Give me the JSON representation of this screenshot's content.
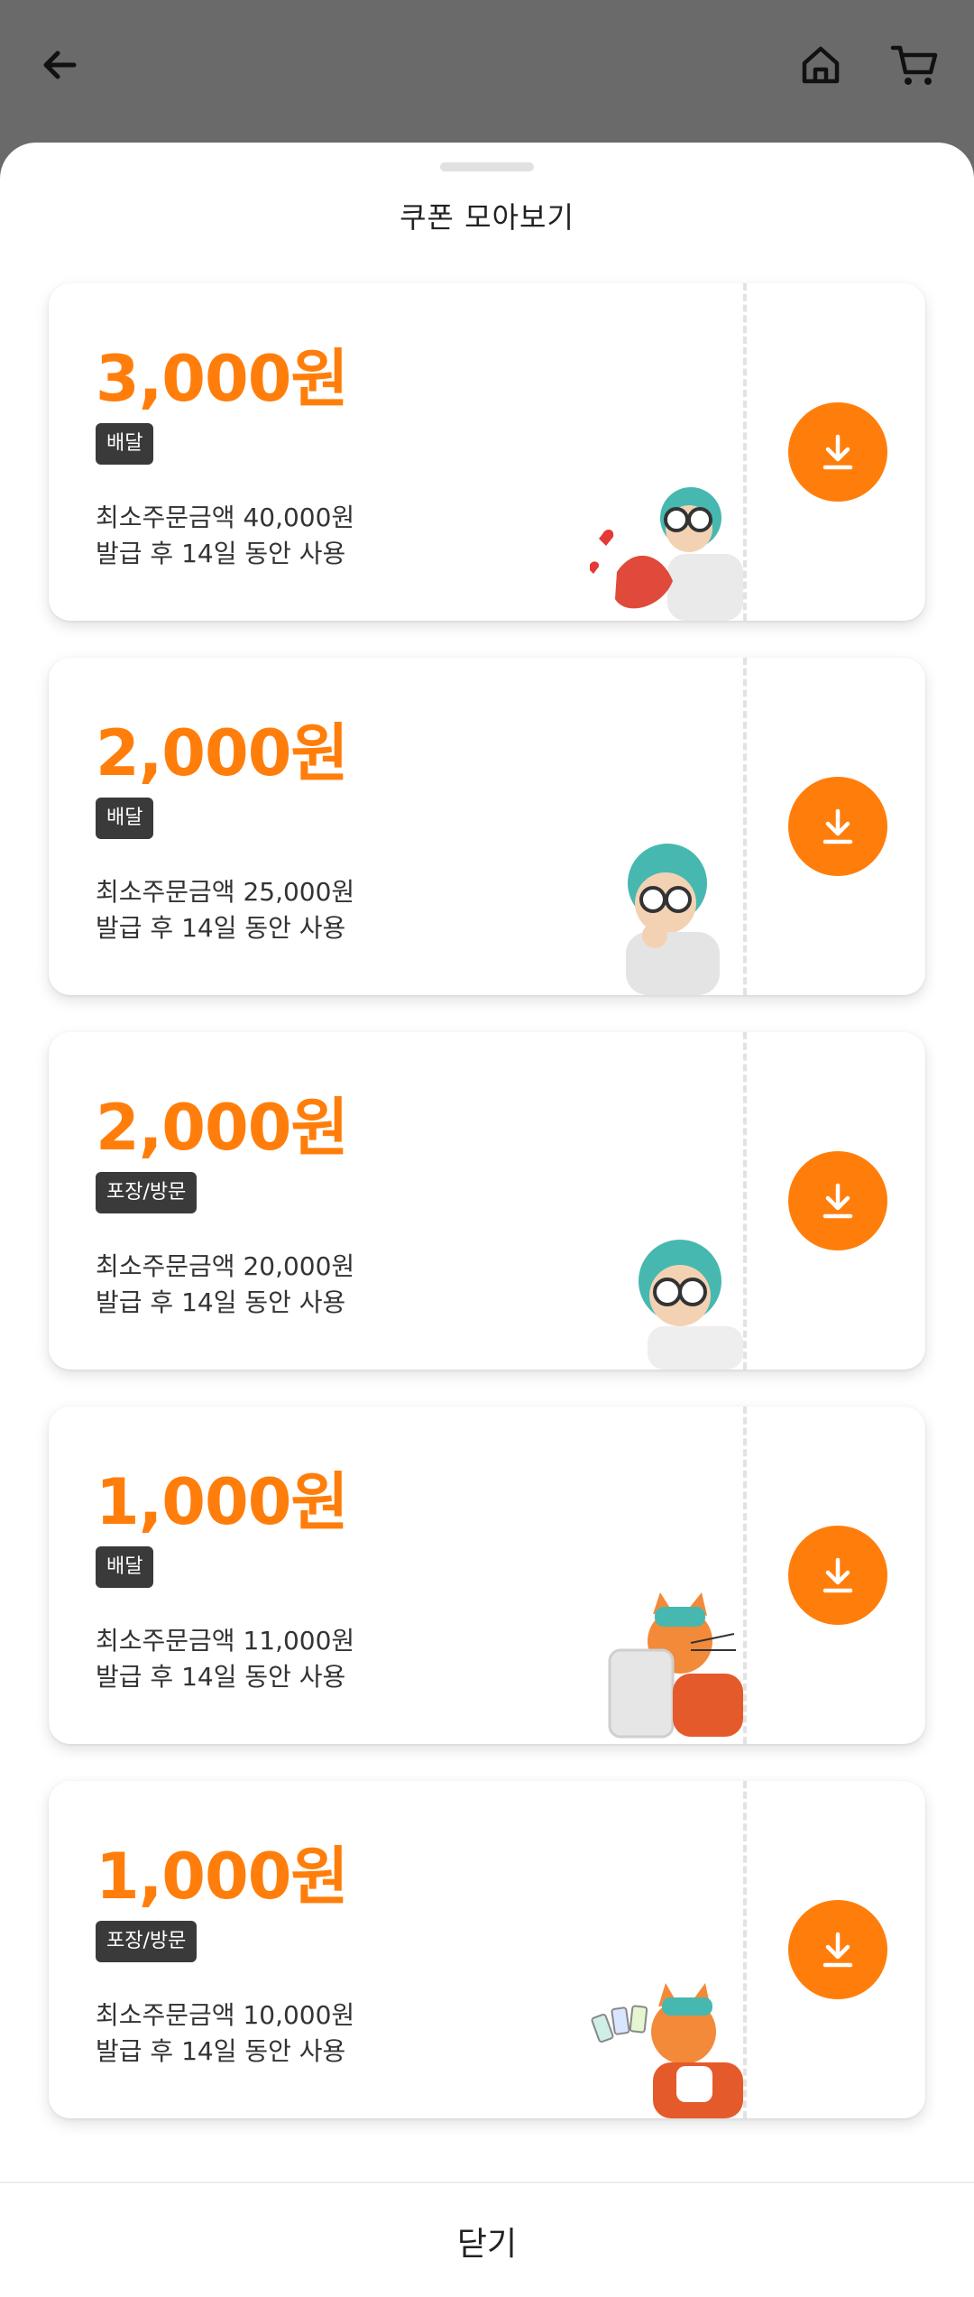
{
  "sheet": {
    "title": "쿠폰 모아보기"
  },
  "coupons": [
    {
      "amount": "3,000원",
      "type": "배달",
      "min_order": "최소주문금액 40,000원",
      "validity": "발급 후 14일 동안 사용"
    },
    {
      "amount": "2,000원",
      "type": "배달",
      "min_order": "최소주문금액 25,000원",
      "validity": "발급 후 14일 동안 사용"
    },
    {
      "amount": "2,000원",
      "type": "포장/방문",
      "min_order": "최소주문금액 20,000원",
      "validity": "발급 후 14일 동안 사용"
    },
    {
      "amount": "1,000원",
      "type": "배달",
      "min_order": "최소주문금액 11,000원",
      "validity": "발급 후 14일 동안 사용"
    },
    {
      "amount": "1,000원",
      "type": "포장/방문",
      "min_order": "최소주문금액 10,000원",
      "validity": "발급 후 14일 동안 사용"
    }
  ],
  "footer": {
    "close_label": "닫기"
  },
  "colors": {
    "accent": "#ff7e0b",
    "badge": "#3a3a3a",
    "overlay": "#6a6a6a"
  },
  "icons": {
    "back": "arrow-left-icon",
    "home": "home-icon",
    "cart": "cart-icon",
    "download": "download-icon"
  }
}
